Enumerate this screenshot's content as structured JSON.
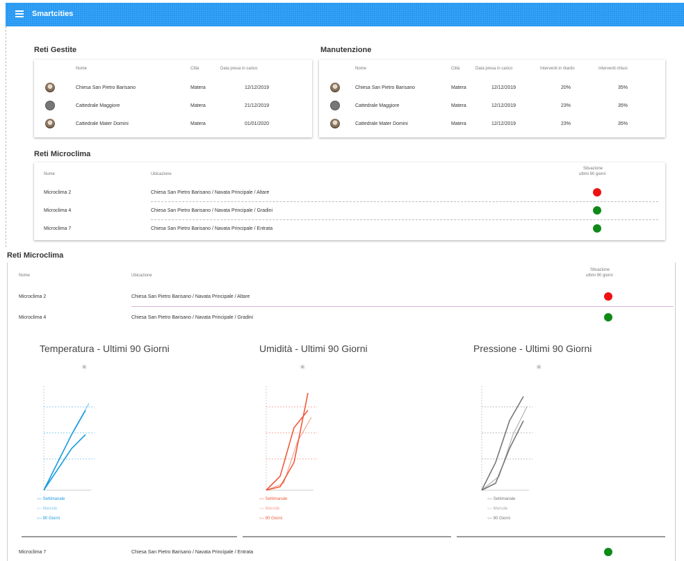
{
  "app": {
    "title": "Smartcities"
  },
  "reti_gestite": {
    "title": "Reti Gestite",
    "headers": [
      "Nome",
      "Città",
      "Data presa in carico"
    ],
    "rows": [
      {
        "avatar": "church",
        "nome": "Chiesa San Pietro Barisano",
        "citta": "Matera",
        "data": "12/12/2019"
      },
      {
        "avatar": "gray",
        "nome": "Cattedrale Maggiore",
        "citta": "Matera",
        "data": "21/12/2019"
      },
      {
        "avatar": "church",
        "nome": "Cattedrale Mater Domini",
        "citta": "Matera",
        "data": "01/01/2020"
      }
    ]
  },
  "manutenzione": {
    "title": "Manutenzione",
    "headers": [
      "Nome",
      "Città",
      "Data presa in carico",
      "Interventi in ritardo",
      "Interventi chiusi"
    ],
    "rows": [
      {
        "avatar": "church",
        "nome": "Chiesa San Pietro Barisano",
        "citta": "Matera",
        "data": "12/12/2019",
        "ritardo": "20%",
        "chiusi": "35%"
      },
      {
        "avatar": "gray",
        "nome": "Cattedrale Maggiore",
        "citta": "Matera",
        "data": "12/12/2019",
        "ritardo": "23%",
        "chiusi": "35%"
      },
      {
        "avatar": "church",
        "nome": "Cattedrale Mater Domini",
        "citta": "Matera",
        "data": "12/12/2019",
        "ritardo": "23%",
        "chiusi": "35%"
      }
    ]
  },
  "reti_microclima": {
    "title": "Reti Microclima",
    "headers": {
      "nome": "Nome",
      "ubicazione": "Ubicazione",
      "situazione_1": "Situazione",
      "situazione_2": "ultimi 90 giorni"
    },
    "rows": [
      {
        "nome": "Microclima 2",
        "ubicazione": "Chiesa San Pietro Barisano / Navata Principale / Altare",
        "status": "red"
      },
      {
        "nome": "Microclima 4",
        "ubicazione": "Chiesa San Pietro Barisano / Navata Principale / Gradini",
        "status": "green"
      },
      {
        "nome": "Microclima 7",
        "ubicazione": "Chiesa San Pietro Barisano / Navata Principale / Entrata",
        "status": "green"
      }
    ]
  },
  "detail": {
    "title": "Reti Microclima",
    "charts": [
      {
        "title": "Temperatura - Ultimi 90 Giorni",
        "color": "#1a9be0",
        "legend": [
          "Settimanale",
          "Mensile",
          "90 Giorni"
        ]
      },
      {
        "title": "Umidità - Ultimi 90 Giorni",
        "color": "#f05a3c",
        "legend": [
          "Settimanale",
          "Mensile",
          "90 Giorni"
        ]
      },
      {
        "title": "Pressione - Ultimi 90 Giorni",
        "color": "#777777",
        "legend": [
          "Settimanale",
          "Mensile",
          "90 Giorni"
        ]
      }
    ]
  },
  "colors": {
    "appbar": "#2196f3",
    "status_red": "#ee1111",
    "status_green": "#0f8a18"
  },
  "icons": {
    "menu": "hamburger-menu-icon",
    "star": "asterisk-icon"
  }
}
